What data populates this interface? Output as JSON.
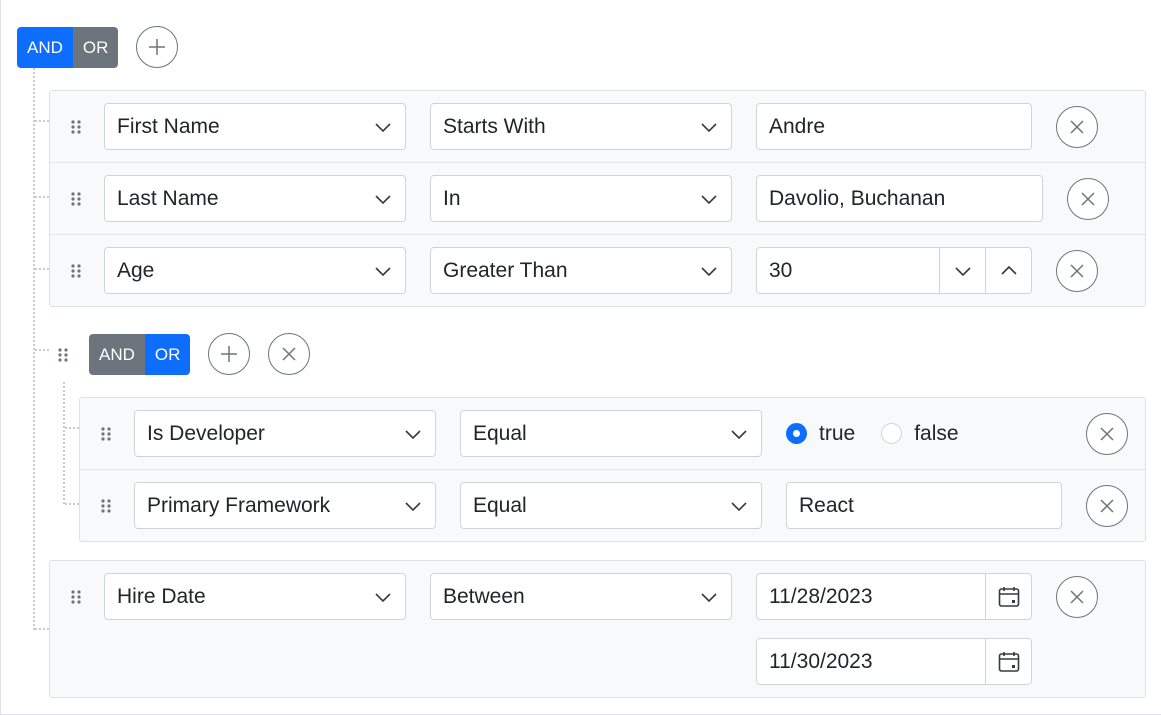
{
  "root_group": {
    "logic": {
      "and_label": "AND",
      "or_label": "OR",
      "active": "AND"
    },
    "add_icon": "plus-icon"
  },
  "rules": [
    {
      "field": "First Name",
      "operator": "Starts With",
      "value": "Andre",
      "remove_icon": "close-icon"
    },
    {
      "field": "Last Name",
      "operator": "In",
      "value": "Davolio, Buchanan",
      "remove_icon": "close-icon"
    },
    {
      "field": "Age",
      "operator": "Greater Than",
      "value": "30",
      "remove_icon": "close-icon"
    }
  ],
  "sub_group": {
    "logic": {
      "and_label": "AND",
      "or_label": "OR",
      "active": "OR"
    },
    "rules": [
      {
        "field": "Is Developer",
        "operator": "Equal",
        "options": [
          "true",
          "false"
        ],
        "selected": "true"
      },
      {
        "field": "Primary Framework",
        "operator": "Equal",
        "value": "React"
      }
    ]
  },
  "last_rule": {
    "field": "Hire Date",
    "operator": "Between",
    "value_from": "11/28/2023",
    "value_to": "11/30/2023"
  },
  "colors": {
    "accent": "#0d6efd",
    "inactive": "#6c757d",
    "panel": "#f8f9fa",
    "border": "#ced4da"
  }
}
